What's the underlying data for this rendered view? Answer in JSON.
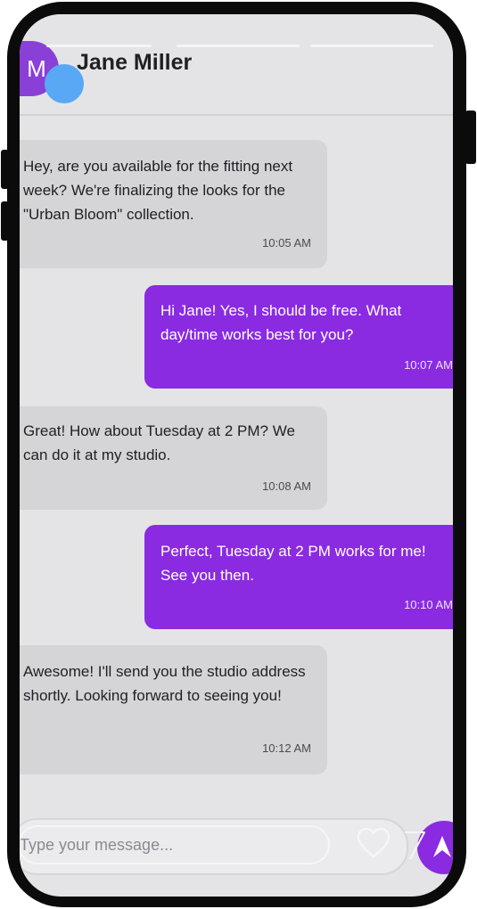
{
  "header": {
    "avatar_initial": "M",
    "contact_name": "Jane Miller"
  },
  "messages": [
    {
      "direction": "incoming",
      "text": "Hey, are you available for the fitting next week? We're finalizing the looks for the \"Urban Bloom\" collection.",
      "time": "10:05 AM"
    },
    {
      "direction": "outgoing",
      "text": "Hi Jane! Yes, I should be free. What day/time works best for you?",
      "time": "10:07 AM"
    },
    {
      "direction": "incoming",
      "text": "Great! How about Tuesday at 2 PM? We can do it at my studio.",
      "time": "10:08 AM"
    },
    {
      "direction": "outgoing",
      "text": "Perfect, Tuesday at 2 PM works for me! See you then.",
      "time": "10:10 AM"
    },
    {
      "direction": "incoming",
      "text": "Awesome! I'll send you the studio address shortly. Looking forward to seeing you!",
      "time": "10:12 AM"
    }
  ],
  "composer": {
    "placeholder": "Type your message...",
    "like_icon": "heart-icon",
    "send_icon": "send-icon"
  },
  "colors": {
    "accent": "#8a2be2",
    "incoming_bubble": "#d5d5d8",
    "background": "#e4e4e6",
    "presence": "#58a8f5"
  }
}
